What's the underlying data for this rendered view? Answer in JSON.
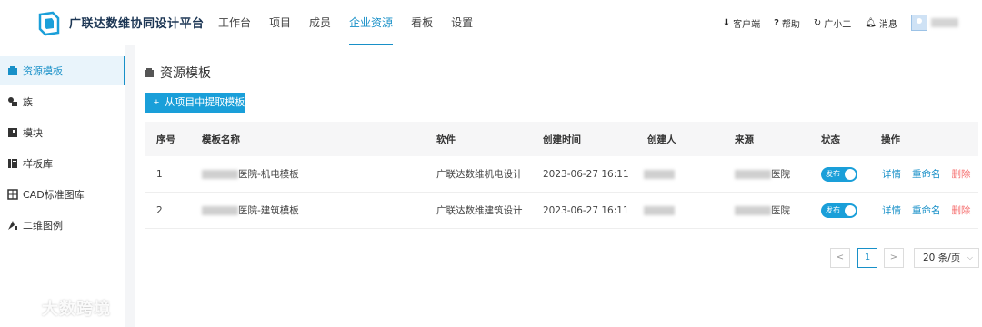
{
  "app": {
    "title": "广联达数维协同设计平台"
  },
  "nav": [
    {
      "label": "工作台",
      "active": false
    },
    {
      "label": "项目",
      "active": false
    },
    {
      "label": "成员",
      "active": false
    },
    {
      "label": "企业资源",
      "active": true
    },
    {
      "label": "看板",
      "active": false
    },
    {
      "label": "设置",
      "active": false
    }
  ],
  "tools": {
    "client": "客户端",
    "help": "帮助",
    "assistant": "广小二",
    "messages": "消息"
  },
  "sidebar": [
    {
      "label": "资源模板",
      "icon": "box-icon",
      "active": true
    },
    {
      "label": "族",
      "icon": "family-icon",
      "active": false
    },
    {
      "label": "模块",
      "icon": "module-icon",
      "active": false
    },
    {
      "label": "样板库",
      "icon": "template-library-icon",
      "active": false
    },
    {
      "label": "CAD标准图库",
      "icon": "cad-grid-icon",
      "active": false
    },
    {
      "label": "二维图例",
      "icon": "legend-icon",
      "active": false
    }
  ],
  "page": {
    "title": "资源模板",
    "extract_button": "从项目中提取模板"
  },
  "table": {
    "headers": [
      "序号",
      "模板名称",
      "软件",
      "创建时间",
      "创建人",
      "来源",
      "状态",
      "操作"
    ],
    "rows": [
      {
        "index": "1",
        "name_suffix": "医院-机电模板",
        "software": "广联达数维机电设计",
        "created": "2023-06-27 16:11",
        "source_suffix": "医院",
        "status": "发布"
      },
      {
        "index": "2",
        "name_suffix": "医院-建筑模板",
        "software": "广联达数维建筑设计",
        "created": "2023-06-27 16:11",
        "source_suffix": "医院",
        "status": "发布"
      }
    ],
    "actions": {
      "detail": "详情",
      "rename": "重命名",
      "delete": "删除"
    }
  },
  "pagination": {
    "prev": "<",
    "current": "1",
    "next": ">",
    "page_size": "20 条/页"
  },
  "watermark": "大数跨境",
  "colors": {
    "accent": "#1890c8",
    "button": "#1a9fd9",
    "danger": "#f56c6c"
  }
}
